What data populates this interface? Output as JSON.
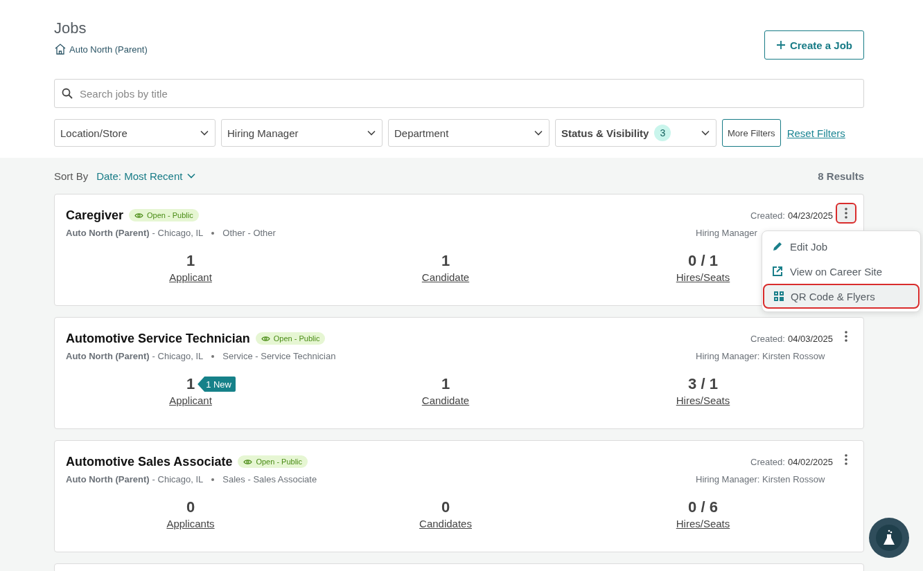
{
  "header": {
    "title": "Jobs",
    "breadcrumb": "Auto North (Parent)",
    "create_button": "Create a Job"
  },
  "search": {
    "placeholder": "Search jobs by title"
  },
  "filters": [
    {
      "label": "Location/Store",
      "bold": false
    },
    {
      "label": "Hiring Manager",
      "bold": false
    },
    {
      "label": "Department",
      "bold": false
    },
    {
      "label": "Status & Visibility",
      "bold": true,
      "count": "3"
    }
  ],
  "more_filters": "More Filters",
  "reset_filters": "Reset Filters",
  "sort": {
    "label": "Sort By",
    "value": "Date: Most Recent"
  },
  "results": "8 Results",
  "jobs": [
    {
      "title": "Caregiver",
      "status": "Open - Public",
      "store": "Auto North (Parent)",
      "location": "- Chicago, IL",
      "department": "Other - Other",
      "created_label": "Created:",
      "created": "04/23/2025",
      "hiring_manager": "Hiring Manager",
      "menu_open": true,
      "stats": [
        {
          "value": "1",
          "label": "Applicant"
        },
        {
          "value": "1",
          "label": "Candidate"
        },
        {
          "value": "0 / 1",
          "label": "Hires/Seats"
        }
      ]
    },
    {
      "title": "Automotive Service Technician",
      "status": "Open - Public",
      "store": "Auto North (Parent)",
      "location": "- Chicago, IL",
      "department": "Service - Service Technician",
      "created_label": "Created:",
      "created": "04/03/2025",
      "hiring_manager": "Hiring Manager: Kirsten Rossow",
      "menu_open": false,
      "stats": [
        {
          "value": "1",
          "label": "Applicant",
          "new": "1 New"
        },
        {
          "value": "1",
          "label": "Candidate"
        },
        {
          "value": "3 / 1",
          "label": "Hires/Seats"
        }
      ]
    },
    {
      "title": "Automotive Sales Associate",
      "status": "Open - Public",
      "store": "Auto North (Parent)",
      "location": "- Chicago, IL",
      "department": "Sales - Sales Associate",
      "created_label": "Created:",
      "created": "04/02/2025",
      "hiring_manager": "Hiring Manager: Kirsten Rossow",
      "menu_open": false,
      "stats": [
        {
          "value": "0",
          "label": "Applicants"
        },
        {
          "value": "0",
          "label": "Candidates"
        },
        {
          "value": "0 / 6",
          "label": "Hires/Seats"
        }
      ]
    }
  ],
  "menu": [
    {
      "label": "Edit Job",
      "kind": "edit",
      "highlighted": false
    },
    {
      "label": "View on Career Site",
      "kind": "external",
      "highlighted": false
    },
    {
      "label": "QR Code & Flyers",
      "kind": "qr",
      "highlighted": true
    }
  ]
}
